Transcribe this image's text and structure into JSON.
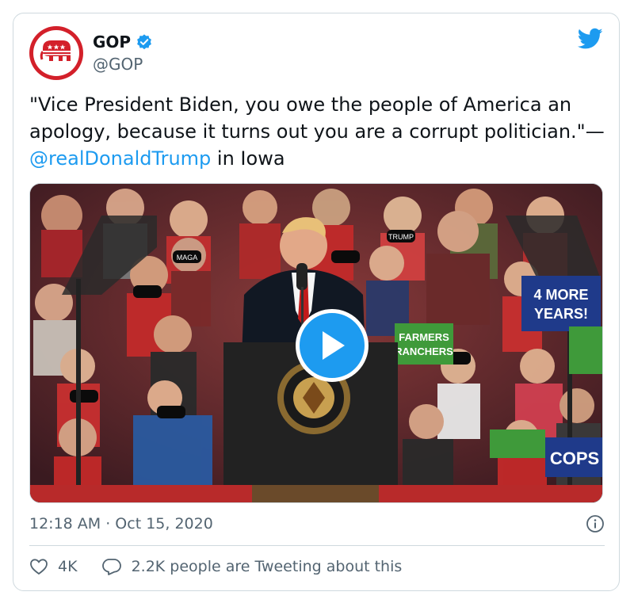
{
  "author": {
    "display_name": "GOP",
    "handle": "@GOP",
    "verified": true,
    "brand_color": "#d3202a"
  },
  "tweet": {
    "text_part1": "\"Vice President Biden, you owe the people of America an apology, because it turns out you are a corrupt politician.\"—",
    "mention": "@realDonaldTrump",
    "text_part2": " in Iowa"
  },
  "media": {
    "type": "video",
    "icon": "play-icon",
    "signs": {
      "four_more_years_line1": "4 MORE",
      "four_more_years_line2": "YEARS!",
      "farmers_ranchers_line1": "FARMERS",
      "farmers_ranchers_line2": "RANCHERS",
      "cops": "COPS",
      "maga": "MAGA",
      "trump": "TRUMP"
    }
  },
  "meta": {
    "timestamp": "12:18 AM · Oct 15, 2020"
  },
  "actions": {
    "likes": "4K",
    "conversation": "2.2K people are Tweeting about this"
  },
  "colors": {
    "accent": "#1d9bf0",
    "muted": "#536471",
    "border": "#cfd9de"
  }
}
